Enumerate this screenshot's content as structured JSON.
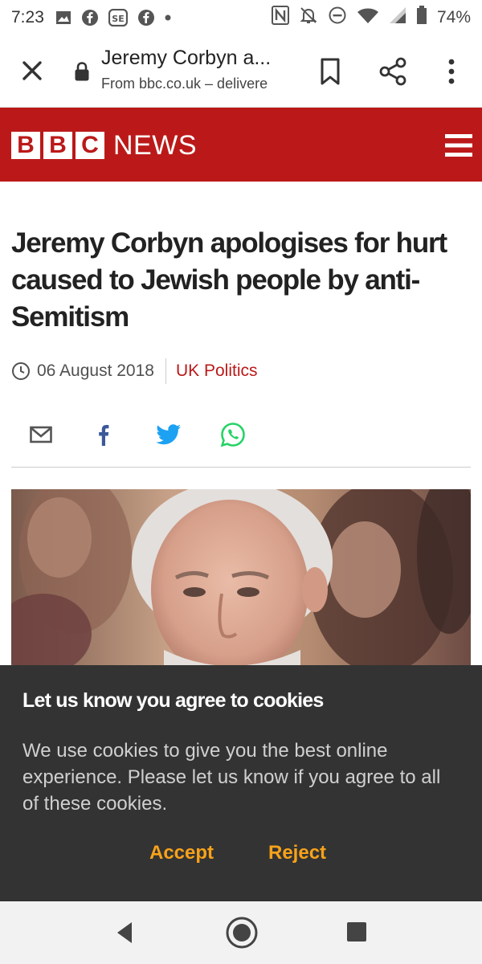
{
  "status_bar": {
    "time": "7:23",
    "battery": "74%",
    "left_icons": [
      "image-icon",
      "facebook-icon",
      "se-icon",
      "facebook-icon",
      "dot-icon"
    ],
    "right_icons": [
      "nfc-icon",
      "notifications-off-icon",
      "do-not-disturb-icon",
      "wifi-icon",
      "signal-icon",
      "battery-icon"
    ]
  },
  "browser": {
    "page_title": "Jeremy Corbyn a...",
    "source": "From bbc.co.uk – delivere"
  },
  "site": {
    "logo_letters": [
      "B",
      "B",
      "C"
    ],
    "logo_word": "NEWS",
    "brand_color": "#bb1919"
  },
  "article": {
    "headline": "Jeremy Corbyn apologises for hurt caused to Jewish people by anti-Semitism",
    "date": "06 August 2018",
    "section": "UK Politics",
    "share_icons": [
      "email-icon",
      "facebook-icon",
      "twitter-icon",
      "whatsapp-icon"
    ]
  },
  "cookie_banner": {
    "title": "Let us know you agree to cookies",
    "body": "We use cookies to give you the best online experience. Please let us know if you agree to all of these cookies.",
    "accept_label": "Accept",
    "reject_label": "Reject",
    "accent_color": "#f7a21a"
  },
  "nav_bar": {
    "icons": [
      "back-icon",
      "home-icon",
      "recents-icon"
    ]
  }
}
